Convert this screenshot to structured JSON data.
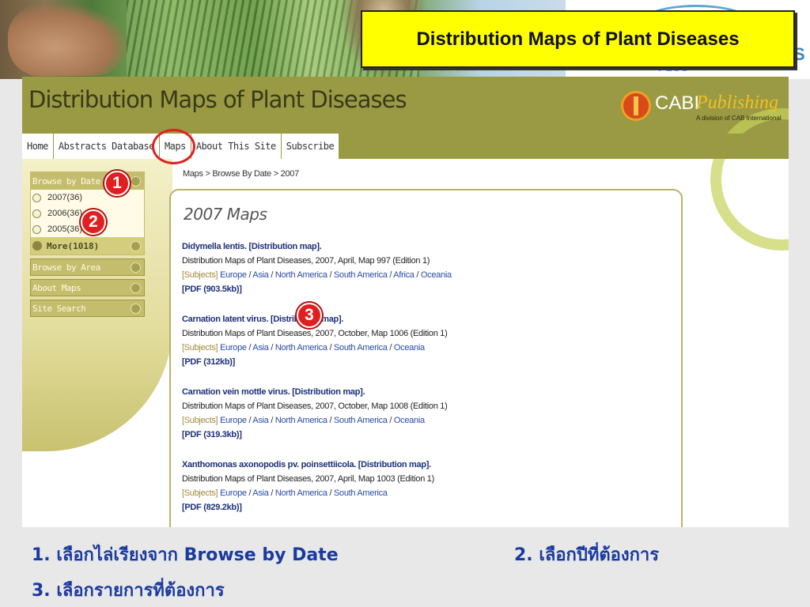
{
  "slide": {
    "title": "Distribution Maps of Plant Diseases",
    "plus_text": "PLUS",
    "s_text": "S"
  },
  "site": {
    "title": "Distribution Maps of Plant Diseases",
    "logo": {
      "cabi": "CABI",
      "publishing": "Publishing",
      "division": "A division of CAB International"
    },
    "nav": [
      "Home",
      "Abstracts Database",
      "Maps",
      "About This Site",
      "Subscribe"
    ]
  },
  "sidebar": {
    "browse_by_date": "Browse by Date",
    "years": [
      "2007(36)",
      "2006(36)",
      "2005(36)"
    ],
    "more": "More(1018)",
    "sections": [
      "Browse by Area",
      "About Maps",
      "Site Search"
    ]
  },
  "breadcrumb": "Maps > Browse By Date > 2007",
  "content": {
    "heading": "2007 Maps",
    "entries": [
      {
        "title": "Didymella lentis. [Distribution map].",
        "meta": "Distribution Maps of Plant Diseases, 2007, April, Map 997 (Edition 1)",
        "subjects_label": "[Subjects]",
        "subjects": [
          "Europe",
          "Asia",
          "North America",
          "South America",
          "Africa",
          "Oceania"
        ],
        "pdf": "[PDF (903.5kb)]"
      },
      {
        "title": "Carnation latent virus. [Distribution map].",
        "meta": "Distribution Maps of Plant Diseases, 2007, October, Map 1006 (Edition 1)",
        "subjects_label": "[Subjects]",
        "subjects": [
          "Europe",
          "Asia",
          "North America",
          "South America",
          "Oceania"
        ],
        "pdf": "[PDF (312kb)]"
      },
      {
        "title": "Carnation vein mottle virus. [Distribution map].",
        "meta": "Distribution Maps of Plant Diseases, 2007, October, Map 1008 (Edition 1)",
        "subjects_label": "[Subjects]",
        "subjects": [
          "Europe",
          "Asia",
          "North America",
          "South America",
          "Oceania"
        ],
        "pdf": "[PDF (319.3kb)]"
      },
      {
        "title": "Xanthomonas axonopodis pv. poinsettiicola. [Distribution map].",
        "meta": "Distribution Maps of Plant Diseases, 2007, April, Map 1003 (Edition 1)",
        "subjects_label": "[Subjects]",
        "subjects": [
          "Europe",
          "Asia",
          "North America",
          "South America"
        ],
        "pdf": "[PDF (829.2kb)]"
      }
    ]
  },
  "badges": [
    "1",
    "2",
    "3"
  ],
  "captions": {
    "step1": "1. เลือกไล่เรียงจาก Browse by Date",
    "step2": "2. เลือกปีที่ต้องการ",
    "step3": "3. เลือกรายการที่ต้องการ"
  },
  "colors": {
    "header_olive": "#9a9a44",
    "highlight_yellow": "#ffff00",
    "badge_red": "#e02020",
    "caption_blue": "#1a3aa0"
  }
}
